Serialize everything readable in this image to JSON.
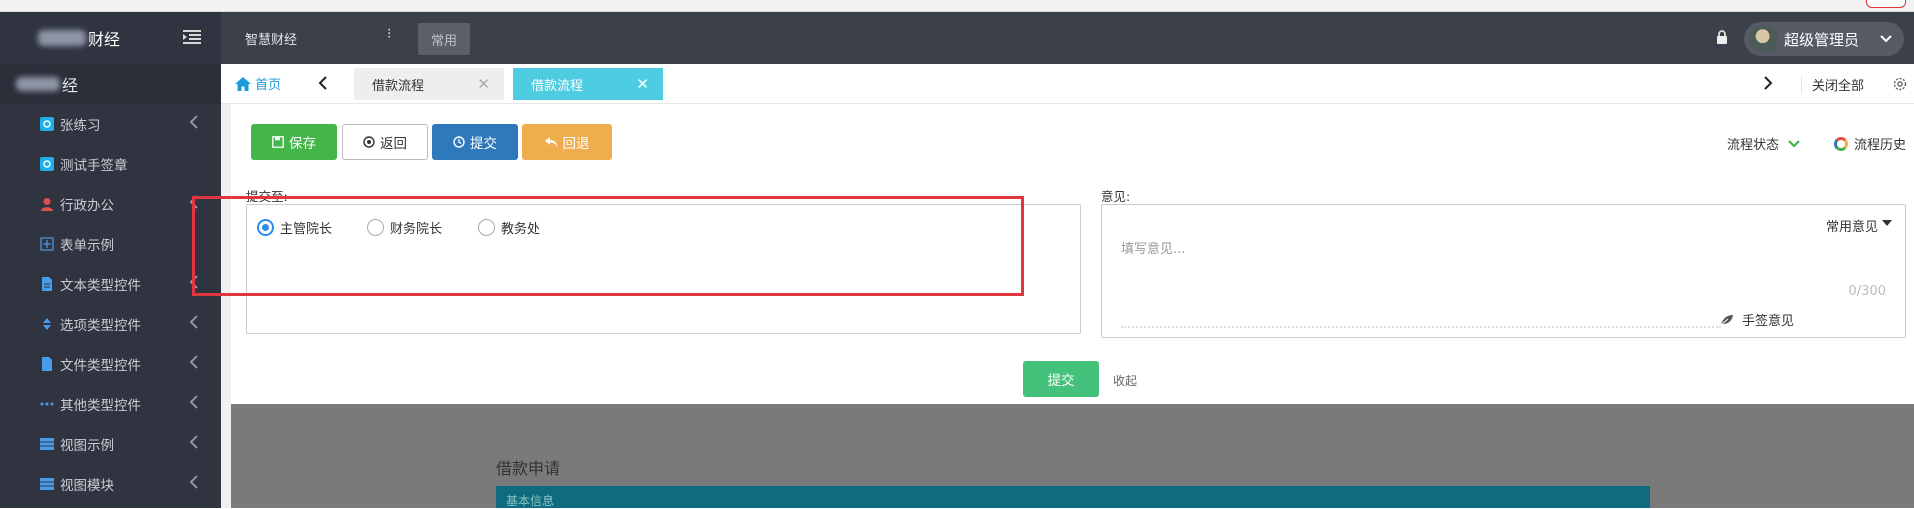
{
  "sidebar": {
    "logo_text": "财经",
    "section_title": "经",
    "items": [
      {
        "label": "张练习",
        "icon": "settings-square-icon",
        "icon_color": "#1fb0e8",
        "has_arrow": true
      },
      {
        "label": "测试手签章",
        "icon": "settings-square-icon",
        "icon_color": "#1fb0e8",
        "has_arrow": false
      },
      {
        "label": "行政办公",
        "icon": "user-icon",
        "icon_color": "#e05050",
        "has_arrow": true
      },
      {
        "label": "表单示例",
        "icon": "grid-plus-icon",
        "icon_color": "#4a9be8",
        "has_arrow": false
      },
      {
        "label": "文本类型控件",
        "icon": "document-icon",
        "icon_color": "#4a9be8",
        "has_arrow": true
      },
      {
        "label": "选项类型控件",
        "icon": "sort-icon",
        "icon_color": "#4a9be8",
        "has_arrow": true
      },
      {
        "label": "文件类型控件",
        "icon": "file-icon",
        "icon_color": "#4a9be8",
        "has_arrow": true
      },
      {
        "label": "其他类型控件",
        "icon": "ellipsis-icon",
        "icon_color": "#4a9be8",
        "has_arrow": true
      },
      {
        "label": "视图示例",
        "icon": "table-icon",
        "icon_color": "#4a9be8",
        "has_arrow": true
      },
      {
        "label": "视图模块",
        "icon": "table-icon",
        "icon_color": "#4a9be8",
        "has_arrow": true
      }
    ]
  },
  "header": {
    "brand": "智慧财经",
    "more_glyph": "⁝",
    "common_label": "常用",
    "user_name": "超级管理员"
  },
  "tabs": {
    "home_label": "首页",
    "items": [
      {
        "label": "借款流程",
        "active": false,
        "close_glyph": "✕"
      },
      {
        "label": "借款流程",
        "active": true,
        "close_glyph": "✕"
      }
    ],
    "close_all_label": "关闭全部"
  },
  "toolbar": {
    "save_label": "保存",
    "back_label": "返回",
    "submit_label": "提交",
    "reject_label": "回退",
    "flow_status_label": "流程状态",
    "flow_history_label": "流程历史"
  },
  "submit_to": {
    "label": "提交至:",
    "options": [
      {
        "label": "主管院长",
        "selected": true
      },
      {
        "label": "财务院长",
        "selected": false
      },
      {
        "label": "教务处",
        "selected": false
      }
    ]
  },
  "opinion": {
    "label": "意见:",
    "common_label": "常用意见",
    "placeholder": "填写意见...",
    "counter": "0/300",
    "sign_label": "手签意见"
  },
  "footer_actions": {
    "submit_label": "提交",
    "collapse_label": "收起"
  },
  "form": {
    "title": "借款申请",
    "section": "基本信息"
  },
  "colors": {
    "sidebar_bg": "#2f3440",
    "header_bg": "#3c404b",
    "active_tab": "#4ecde2",
    "save": "#44b549",
    "submit": "#2d79bb",
    "reject": "#f0ad4e",
    "highlight": "#e0373f"
  }
}
